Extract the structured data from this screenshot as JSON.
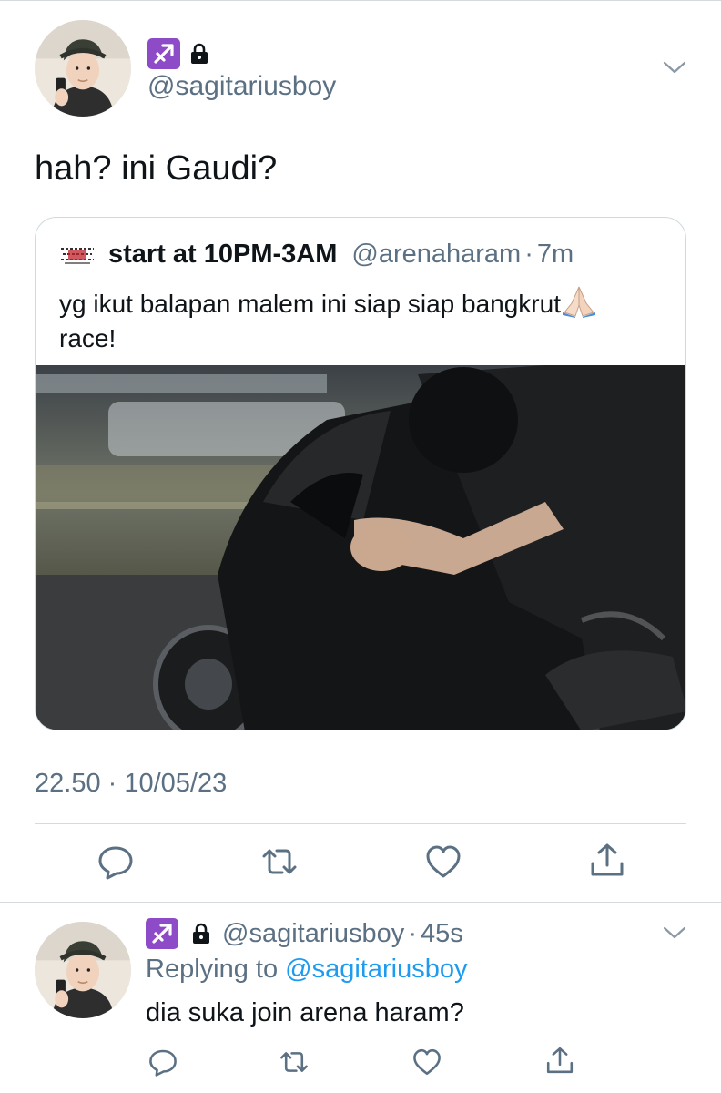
{
  "main_tweet": {
    "handle": "@sagitariusboy",
    "text": "hah? ini Gaudi?",
    "timestamp": "22.50 · 10/05/23",
    "badge_icons": [
      "sagittarius-icon",
      "lock-icon"
    ]
  },
  "quoted_tweet": {
    "display_name": "start at 10PM-3AM",
    "handle": "@arenaharam",
    "separator": "·",
    "time": "7m",
    "text": "yg ikut balapan malem ini siap siap bangkrut",
    "text_line2": "race!",
    "emoji_icon": "folded-hands-icon",
    "media_description_icon": "motorcycle-photo"
  },
  "actions": [
    "reply-icon",
    "retweet-icon",
    "like-icon",
    "share-icon"
  ],
  "reply_tweet": {
    "handle": "@sagitariusboy",
    "separator": "·",
    "time": "45s",
    "replying_prefix": "Replying to",
    "replying_to": "@sagitariusboy",
    "text": "dia suka join arena haram?"
  },
  "colors": {
    "secondary_text": "#5b7083",
    "link": "#1d9bf0",
    "sagittarius_badge": "#8e4bc7",
    "border": "#cfd9de"
  }
}
